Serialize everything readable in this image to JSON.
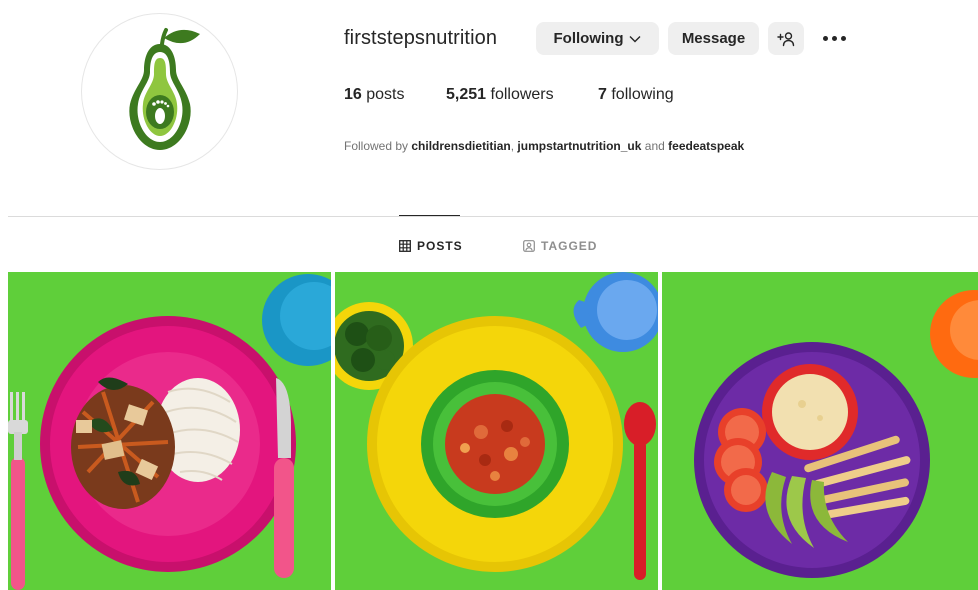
{
  "profile": {
    "username": "firststepsnutrition",
    "following_label": "Following",
    "message_label": "Message",
    "stats": {
      "posts_count": "16",
      "posts_label": "posts",
      "followers_count": "5,251",
      "followers_label": "followers",
      "following_count": "7",
      "following_label": "following"
    },
    "followed_by": {
      "prefix": "Followed by",
      "user1": "childrensdietitian",
      "separator": ",",
      "user2": "jumpstartnutrition_uk",
      "conjunction": "and",
      "user3": "feedeatspeak"
    }
  },
  "tabs": [
    {
      "label": "POSTS",
      "icon": "grid-icon",
      "active": true
    },
    {
      "label": "TAGGED",
      "icon": "tagged-icon",
      "active": false
    }
  ],
  "posts": [
    {
      "name": "pink-plate-tofu-noodles",
      "plate_color": "#e3157e",
      "background": "#5fcf3a"
    },
    {
      "name": "yellow-plate-green-bowl",
      "plate_color": "#f4d60a",
      "background": "#5fcf3a"
    },
    {
      "name": "purple-plate-hummus",
      "plate_color": "#6d2ba6",
      "background": "#5fcf3a"
    }
  ],
  "colors": {
    "button_bg": "#efefef",
    "text_primary": "#262626",
    "text_secondary": "#737373",
    "divider": "#dbdbdb",
    "logo_dark_green": "#3d7a1f",
    "logo_light_green": "#8fc63f"
  }
}
